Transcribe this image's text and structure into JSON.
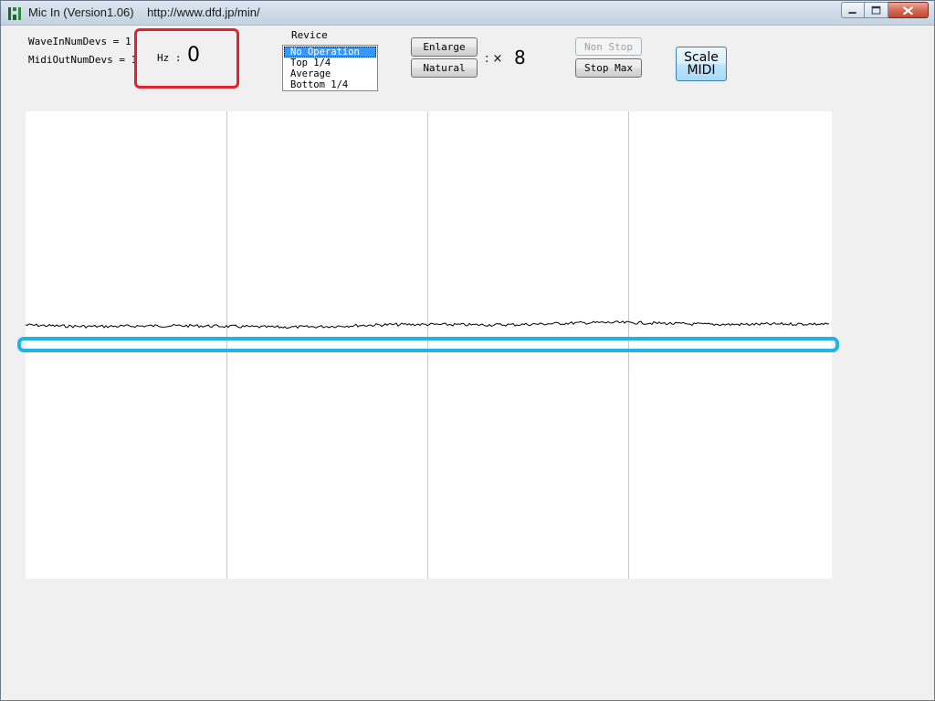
{
  "window": {
    "title": "Mic In (Version1.06)",
    "url": "http://www.dfd.jp/min/",
    "icon": "app-icon"
  },
  "devices": {
    "wave_in": "WaveInNumDevs = 1",
    "midi_out": "MidiOutNumDevs = 1"
  },
  "hz": {
    "label": "Hz :",
    "value": "0",
    "highlight_color": "#e0232e"
  },
  "revice": {
    "label": "Revice",
    "options": [
      "No Operation",
      "Top 1/4",
      "Average",
      "Bottom 1/4"
    ],
    "selected": "No Operation"
  },
  "zoom": {
    "enlarge_label": "Enlarge",
    "natural_label": "Natural",
    "multiplier_label": ": ×",
    "multiplier_value": "8"
  },
  "stop": {
    "non_stop_label": "Non Stop",
    "stop_max_label": "Stop Max"
  },
  "scale_button": {
    "line1": "Scale",
    "line2": "MIDI"
  },
  "waveform": {
    "highlight_color": "#1eb4e6",
    "line_color": "#000000",
    "grid_color": "#c8c8c8"
  }
}
